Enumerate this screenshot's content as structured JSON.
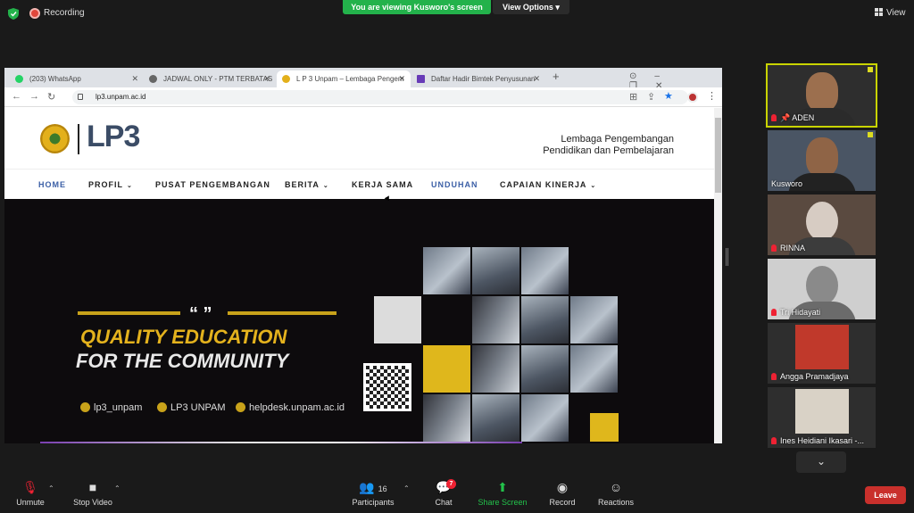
{
  "topbar": {
    "recording_label": "Recording",
    "viewing_banner": "You are viewing Kusworo's screen",
    "view_options": "View Options",
    "view_label": "View"
  },
  "browser": {
    "tabs": [
      {
        "label": "(203) WhatsApp",
        "icon": "whatsapp-icon",
        "color": "#25d366"
      },
      {
        "label": "JADWAL ONLY - PTM TERBATAS",
        "icon": "globe-icon",
        "color": "#555555"
      },
      {
        "label": "L P 3 Unpam – Lembaga Pengem",
        "icon": "lp3-favicon",
        "color": "#e3b01b"
      },
      {
        "label": "Daftar Hadir Bimtek Penyusunan",
        "icon": "forms-icon",
        "color": "#673ab7"
      }
    ],
    "url": "lp3.unpam.ac.id"
  },
  "site": {
    "logo_text": "LP3",
    "tagline_line1": "Lembaga Pengembangan",
    "tagline_line2": "Pendidikan dan Pembelajaran",
    "menu": [
      {
        "label": "HOME",
        "dropdown": false,
        "highlight": true
      },
      {
        "label": "PROFIL",
        "dropdown": true,
        "highlight": false
      },
      {
        "label": "PUSAT PENGEMBANGAN",
        "dropdown": false,
        "highlight": false
      },
      {
        "label": "BERITA",
        "dropdown": true,
        "highlight": false
      },
      {
        "label": "KERJA SAMA",
        "dropdown": false,
        "highlight": false
      },
      {
        "label": "UNDUHAN",
        "dropdown": false,
        "highlight": true
      },
      {
        "label": "CAPAIAN KINERJA",
        "dropdown": true,
        "highlight": false
      }
    ],
    "banner": {
      "quote_mark": "“ ”",
      "headline_1": "QUALITY EDUCATION",
      "headline_2": "FOR THE COMMUNITY",
      "instagram": "lp3_unpam",
      "youtube": "LP3 UNPAM",
      "helpdesk": "helpdesk.unpam.ac.id"
    }
  },
  "participants": [
    {
      "name": "ADEN",
      "muted": true,
      "pinned": true,
      "active": true
    },
    {
      "name": "Kusworo",
      "muted": false,
      "pinned": false,
      "active": false
    },
    {
      "name": "RINNA",
      "muted": true,
      "pinned": false,
      "active": false
    },
    {
      "name": "Tri Hidayati",
      "muted": true,
      "pinned": false,
      "active": false
    },
    {
      "name": "Angga Pramadjaya",
      "muted": true,
      "pinned": false,
      "active": false
    },
    {
      "name": "Ines Heidiani Ikasari -...",
      "muted": true,
      "pinned": false,
      "active": false
    }
  ],
  "toolbar": {
    "unmute": "Unmute",
    "stop_video": "Stop Video",
    "participants_label": "Participants",
    "participants_count": "16",
    "chat": "Chat",
    "chat_badge": "7",
    "share_screen": "Share Screen",
    "record": "Record",
    "reactions": "Reactions",
    "leave": "Leave"
  },
  "colors": {
    "accent_green": "#23b24b",
    "leave_red": "#c9302c",
    "banner_gold": "#e4b21d",
    "menu_highlight": "#3b5fa6"
  }
}
